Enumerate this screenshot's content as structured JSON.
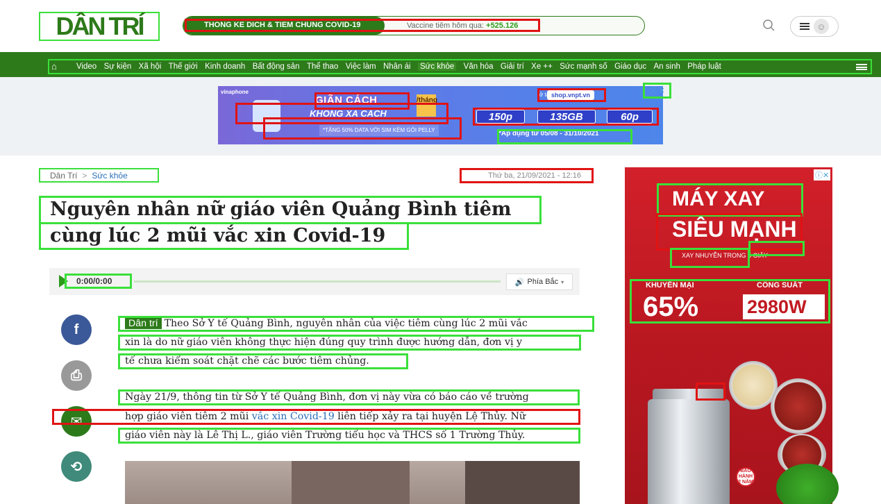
{
  "header": {
    "logo": "DÂN TRÍ",
    "covid_title": "THONG KE DICH & TIEM CHUNG COVID-19",
    "covid_label": "Vaccine tiêm hôm qua:",
    "covid_value": "+525.126"
  },
  "nav": {
    "items": [
      "Video",
      "Sự kiện",
      "Xã hội",
      "Thế giới",
      "Kinh doanh",
      "Bất động sản",
      "Thể thao",
      "Việc làm",
      "Nhân ái",
      "Sức khỏe",
      "Văn hóa",
      "Giải trí",
      "Xe ++",
      "Sức mạnh số",
      "Giáo dục",
      "An sinh",
      "Pháp luật"
    ],
    "active": "Sức khỏe"
  },
  "banner_ad": {
    "brand": "vinaphone",
    "title1": "GIÃN CÁCH",
    "title2": "KHÔNG XA CÁCH",
    "price": "/tháng",
    "promo": "*TẶNG 50% DATA VỚI SIM KÈM GÓI PELLY",
    "shop_label": "ở tại",
    "shop": "shop.vnpt.vn",
    "options": [
      "150p",
      "135GB",
      "60p"
    ],
    "dates": "*Áp dụng từ 05/08 - 31/10/2021"
  },
  "article": {
    "breadcrumb_home": "Dân Trí",
    "breadcrumb_sep": ">",
    "breadcrumb_cat": "Sức khỏe",
    "date": "Thứ ba, 21/09/2021 - 12:16",
    "title_line1": "Nguyên nhân nữ giáo viên Quảng Bình tiêm",
    "title_line2": "cùng lúc 2 mũi vắc xin Covid-19",
    "audio_time": "0:00/0:00",
    "audio_voice": "Phía Bắc",
    "source_tag": "Dân trí",
    "p1_line1": "Theo Sở Y tế Quảng Bình, nguyên nhân của việc tiêm cùng lúc 2 mũi vắc",
    "p1_line2": "xin là do nữ giáo viên không thực hiện đúng quy trình được hướng dẫn, đơn vị y",
    "p1_line3": "tế chưa kiểm soát chặt chẽ các bước tiêm chủng.",
    "p2_line1": "Ngày 21/9, thông tin từ Sở Y tế Quảng Bình, đơn vị này vừa có báo cáo về trường",
    "p2_line2_a": "hợp giáo viên tiêm 2 mũi ",
    "p2_line2_link": "vắc xin Covid-19",
    "p2_line2_b": " liên tiếp xảy ra tại huyện Lệ Thủy. Nữ",
    "p2_line3": "giáo viên này là Lê Thị L., giáo viên Trường tiểu học và THCS số 1 Trường Thủy."
  },
  "side_ad": {
    "line1": "MÁY XAY",
    "line2": "SIÊU MẠNH",
    "line3": "XAY NHUYỄN TRONG 5 GIÂY",
    "promo_label": "KHUYẾN MẠI",
    "promo_value": "65%",
    "power_label": "CÔNG SUẤT",
    "power_value": "2980W",
    "warranty": "BẢO HÀNH 2 NĂM"
  }
}
